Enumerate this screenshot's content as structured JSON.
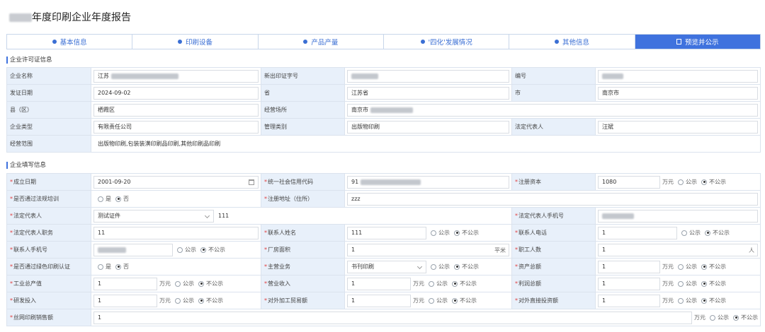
{
  "page": {
    "title": "年度印刷企业年度报告"
  },
  "tabs": [
    {
      "label": "基本信息"
    },
    {
      "label": "印刷设备"
    },
    {
      "label": "产品产量"
    },
    {
      "label": "'四化'发展情况"
    },
    {
      "label": "其他信息"
    },
    {
      "label": "预览并公示"
    }
  ],
  "license_section": {
    "title": "企业许可证信息",
    "company_name_label": "企业名称",
    "company_name_value": "江苏",
    "new_license_label": "新出印证字号",
    "number_label": "编号",
    "issue_date_label": "发证日期",
    "issue_date_value": "2024-09-02",
    "province_label": "省",
    "province_value": "江苏省",
    "city_label": "市",
    "city_value": "南京市",
    "county_label": "县（区）",
    "county_value": "栖霞区",
    "address_label": "经营场所",
    "address_value": "南京市",
    "company_type_label": "企业类型",
    "company_type_value": "有限责任公司",
    "category_label": "管理类别",
    "category_value": "出版物印刷",
    "legal_rep_label": "法定代表人",
    "legal_rep_value": "汪斌",
    "scope_label": "经营范围",
    "scope_value": "出版物印刷,包装装潢印刷品印刷,其他印刷品印刷"
  },
  "fill_section": {
    "title": "企业填写信息",
    "required_mark": "*",
    "public_label": "公示",
    "not_public_label": "不公示",
    "yes_label": "是",
    "no_label": "否",
    "unit_wan": "万元",
    "unit_sqm": "平米",
    "unit_person": "人",
    "founded_label": "成立日期",
    "founded_value": "2001-09-20",
    "credit_code_label": "统一社会信用代码",
    "credit_code_value": "91",
    "capital_label": "注册资本",
    "capital_value": "1080",
    "training_label": "是否通过法规培训",
    "reg_address_label": "注册地址（住所）",
    "reg_address_value": "zzz",
    "legal_rep_label": "法定代表人",
    "id_type_value": "测试证件",
    "id_number_value": "111",
    "legal_phone_label": "法定代表人手机号",
    "legal_title_label": "法定代表人职务",
    "legal_title_value": "11",
    "contact_name_label": "联系人姓名",
    "contact_name_value": "111",
    "contact_tel_label": "联系人电话",
    "contact_tel_value": "1",
    "contact_mobile_label": "联系人手机号",
    "plant_area_label": "厂房面积",
    "plant_area_value": "1",
    "staff_label": "职工人数",
    "staff_value": "1",
    "green_label": "是否通过绿色印刷认证",
    "main_business_label": "主营业务",
    "main_business_value": "书刊印刷",
    "assets_label": "资产总额",
    "assets_value": "1",
    "output_label": "工业总产值",
    "output_value": "1",
    "revenue_label": "营业收入",
    "revenue_value": "1",
    "profit_label": "利润总额",
    "profit_value": "1",
    "rnd_label": "研发投入",
    "rnd_value": "1",
    "trade_label": "对外加工贸易额",
    "trade_value": "1",
    "fdi_label": "对外直接投资额",
    "fdi_value": "1",
    "silk_label": "丝网印刷销售额",
    "silk_value": "1"
  },
  "colors": {
    "accent": "#3f72de",
    "label_bg": "#e8f0fa",
    "required": "#e04040"
  }
}
